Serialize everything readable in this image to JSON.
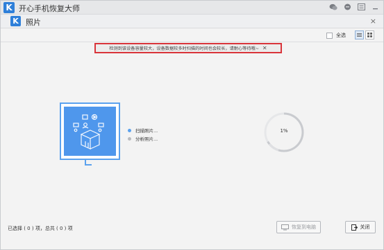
{
  "app": {
    "title": "开心手机恢复大师",
    "logo_letter": "K"
  },
  "titlebar_icons": [
    "wechat-icon",
    "chat-icon",
    "menu-icon",
    "minimize-icon"
  ],
  "tab": {
    "title": "照片",
    "logo_letter": "K",
    "close_glyph": "×"
  },
  "toolbar": {
    "select_all_label": "全选",
    "select_all_checked": false
  },
  "notice": {
    "text": "检测到该设备容量较大，设备数据较多时扫描的时间也会较长，请耐心等待哦~",
    "close_glyph": "✕"
  },
  "steps": [
    {
      "label": "扫描照片...",
      "color": "#5aa1ee"
    },
    {
      "label": "分析照片...",
      "color": "#b9bbbf"
    }
  ],
  "progress": {
    "label": "1%",
    "value": 0.01
  },
  "status": {
    "text": "已选择 ( 0 ) 项，总共 ( 0 ) 项"
  },
  "buttons": {
    "restore_label": "恢复到电脑",
    "close_label": "关闭"
  },
  "colors": {
    "accent": "#4f97ec",
    "notice_border": "#d9343a"
  }
}
